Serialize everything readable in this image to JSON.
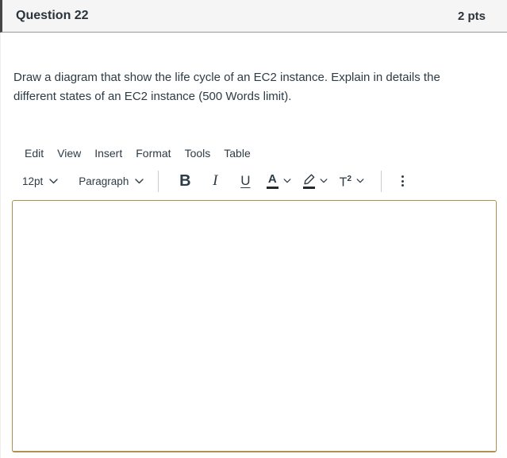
{
  "header": {
    "title": "Question 22",
    "points": "2 pts"
  },
  "question": {
    "text": "Draw a diagram that show the life cycle of an EC2 instance. Explain in details the different states of an EC2 instance (500 Words limit)."
  },
  "editor": {
    "menu": [
      "Edit",
      "View",
      "Insert",
      "Format",
      "Tools",
      "Table"
    ],
    "font_size_value": "12pt",
    "paragraph_format_value": "Paragraph",
    "bold_label": "B",
    "italic_label": "I",
    "underline_label": "U",
    "text_color_label": "A",
    "superscript_base": "T",
    "superscript_exponent": "2",
    "textarea_value": "",
    "icons": {
      "dropdowns": "chevron-down-icon",
      "highlight": "highlighter-pen-icon",
      "more": "kebab-menu-icon"
    }
  },
  "colors": {
    "header_background": "#f5f5f5",
    "header_border": "#9a9a9a",
    "editor_border": "#ae9150",
    "text": "#2d3b45",
    "swatch_bar": "#24292e"
  }
}
